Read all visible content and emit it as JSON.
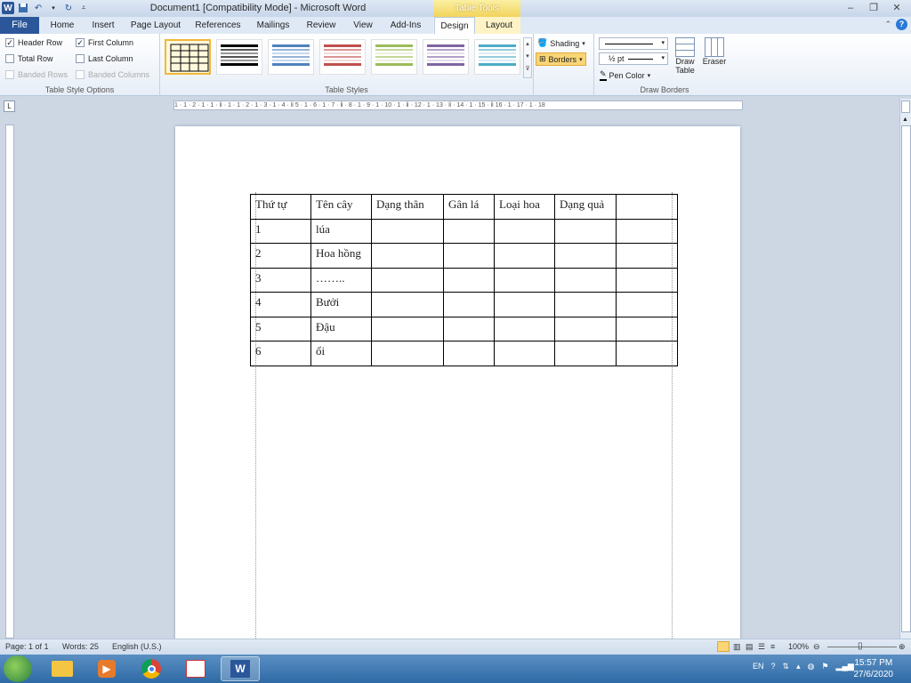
{
  "window": {
    "title": "Document1 [Compatibility Mode] - Microsoft Word",
    "contextual_tab_group": "Table Tools",
    "accent": "#2b579a"
  },
  "tabs": [
    {
      "label": "File",
      "active": false
    },
    {
      "label": "Home",
      "active": false
    },
    {
      "label": "Insert",
      "active": false
    },
    {
      "label": "Page Layout",
      "active": false
    },
    {
      "label": "References",
      "active": false
    },
    {
      "label": "Mailings",
      "active": false
    },
    {
      "label": "Review",
      "active": false
    },
    {
      "label": "View",
      "active": false
    },
    {
      "label": "Add-Ins",
      "active": false
    },
    {
      "label": "Design",
      "active": true
    },
    {
      "label": "Layout",
      "active": false
    }
  ],
  "ribbon": {
    "table_style_options": {
      "label": "Table Style Options",
      "header_row": "Header Row",
      "header_row_checked": true,
      "first_column": "First Column",
      "first_column_checked": true,
      "total_row": "Total Row",
      "total_row_checked": false,
      "last_column": "Last Column",
      "last_column_checked": false,
      "banded_rows": "Banded Rows",
      "banded_rows_checked": false,
      "banded_columns": "Banded Columns",
      "banded_columns_checked": false
    },
    "table_styles": {
      "label": "Table Styles",
      "shading": "Shading",
      "borders": "Borders"
    },
    "draw_borders": {
      "label": "Draw Borders",
      "line_weight": "½ pt",
      "pen_color": "Pen Color",
      "draw_table": "Draw Table",
      "eraser": "Eraser"
    }
  },
  "ruler_text": "1 · 1 · 2 · 1 · 1 · ⅱ · 1 · 1 · 2 · 1 · 3 · 1 · 4 · ⅱ 5 · 1 · 6 · 1 · 7 · ⅱ · 8 · 1 · 9 · 1 · 10 · 1 · ⅱ · 12 · 1 · 13 · ⅱ · 14 · 1 · 15 · ⅱ 16 · 1 · 17 · 1 · 18",
  "table": {
    "headers": [
      "Thứ tự",
      "Tên cây",
      "Dạng thân",
      "Gân lá",
      "Loại hoa",
      "Dạng quả",
      ""
    ],
    "rows": [
      [
        "1",
        "lúa",
        "",
        "",
        "",
        "",
        ""
      ],
      [
        "2",
        "Hoa hồng",
        "",
        "",
        "",
        "",
        ""
      ],
      [
        "3",
        "……..",
        "",
        "",
        "",
        "",
        ""
      ],
      [
        "4",
        "Bưởi",
        "",
        "",
        "",
        "",
        ""
      ],
      [
        "5",
        "Đậu",
        "",
        "",
        "",
        "",
        ""
      ],
      [
        "6",
        "ổi",
        "",
        "",
        "",
        "",
        ""
      ]
    ]
  },
  "status": {
    "page": "Page: 1 of 1",
    "words": "Words: 25",
    "language": "English (U.S.)",
    "zoom": "100%"
  },
  "taskbar": {
    "lang": "EN",
    "time": "15:57 PM",
    "date": "27/6/2020"
  }
}
